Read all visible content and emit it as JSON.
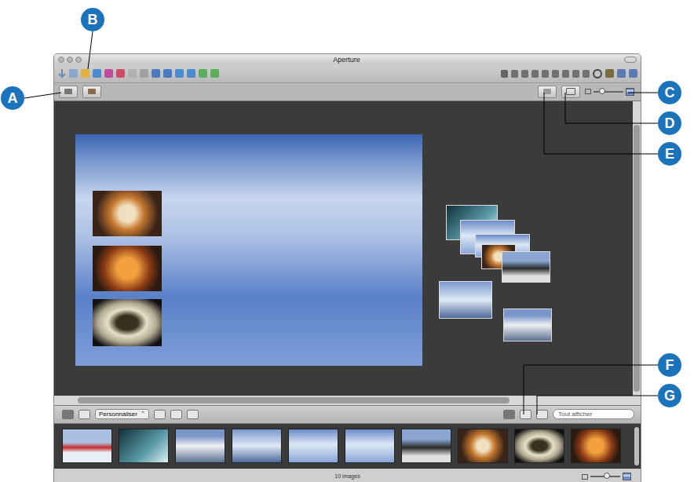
{
  "window": {
    "title": "Aperture"
  },
  "callouts": [
    {
      "label": "A"
    },
    {
      "label": "B"
    },
    {
      "label": "C"
    },
    {
      "label": "D"
    },
    {
      "label": "E"
    },
    {
      "label": "F"
    },
    {
      "label": "G"
    }
  ],
  "toolbar_zoom": {
    "level": 0.3
  },
  "browser_bar": {
    "preset": "Personnaliser",
    "search": {
      "placeholder": "Tout afficher"
    }
  },
  "filmstrip": [
    {
      "selected": false
    },
    {
      "selected": false
    },
    {
      "selected": false
    },
    {
      "selected": false
    },
    {
      "selected": false
    },
    {
      "selected": false
    },
    {
      "selected": false
    },
    {
      "selected": false
    },
    {
      "selected": false
    },
    {
      "selected": false
    }
  ],
  "status_bar": {
    "text": "10 images",
    "zoom": {
      "level": 0.55
    }
  }
}
